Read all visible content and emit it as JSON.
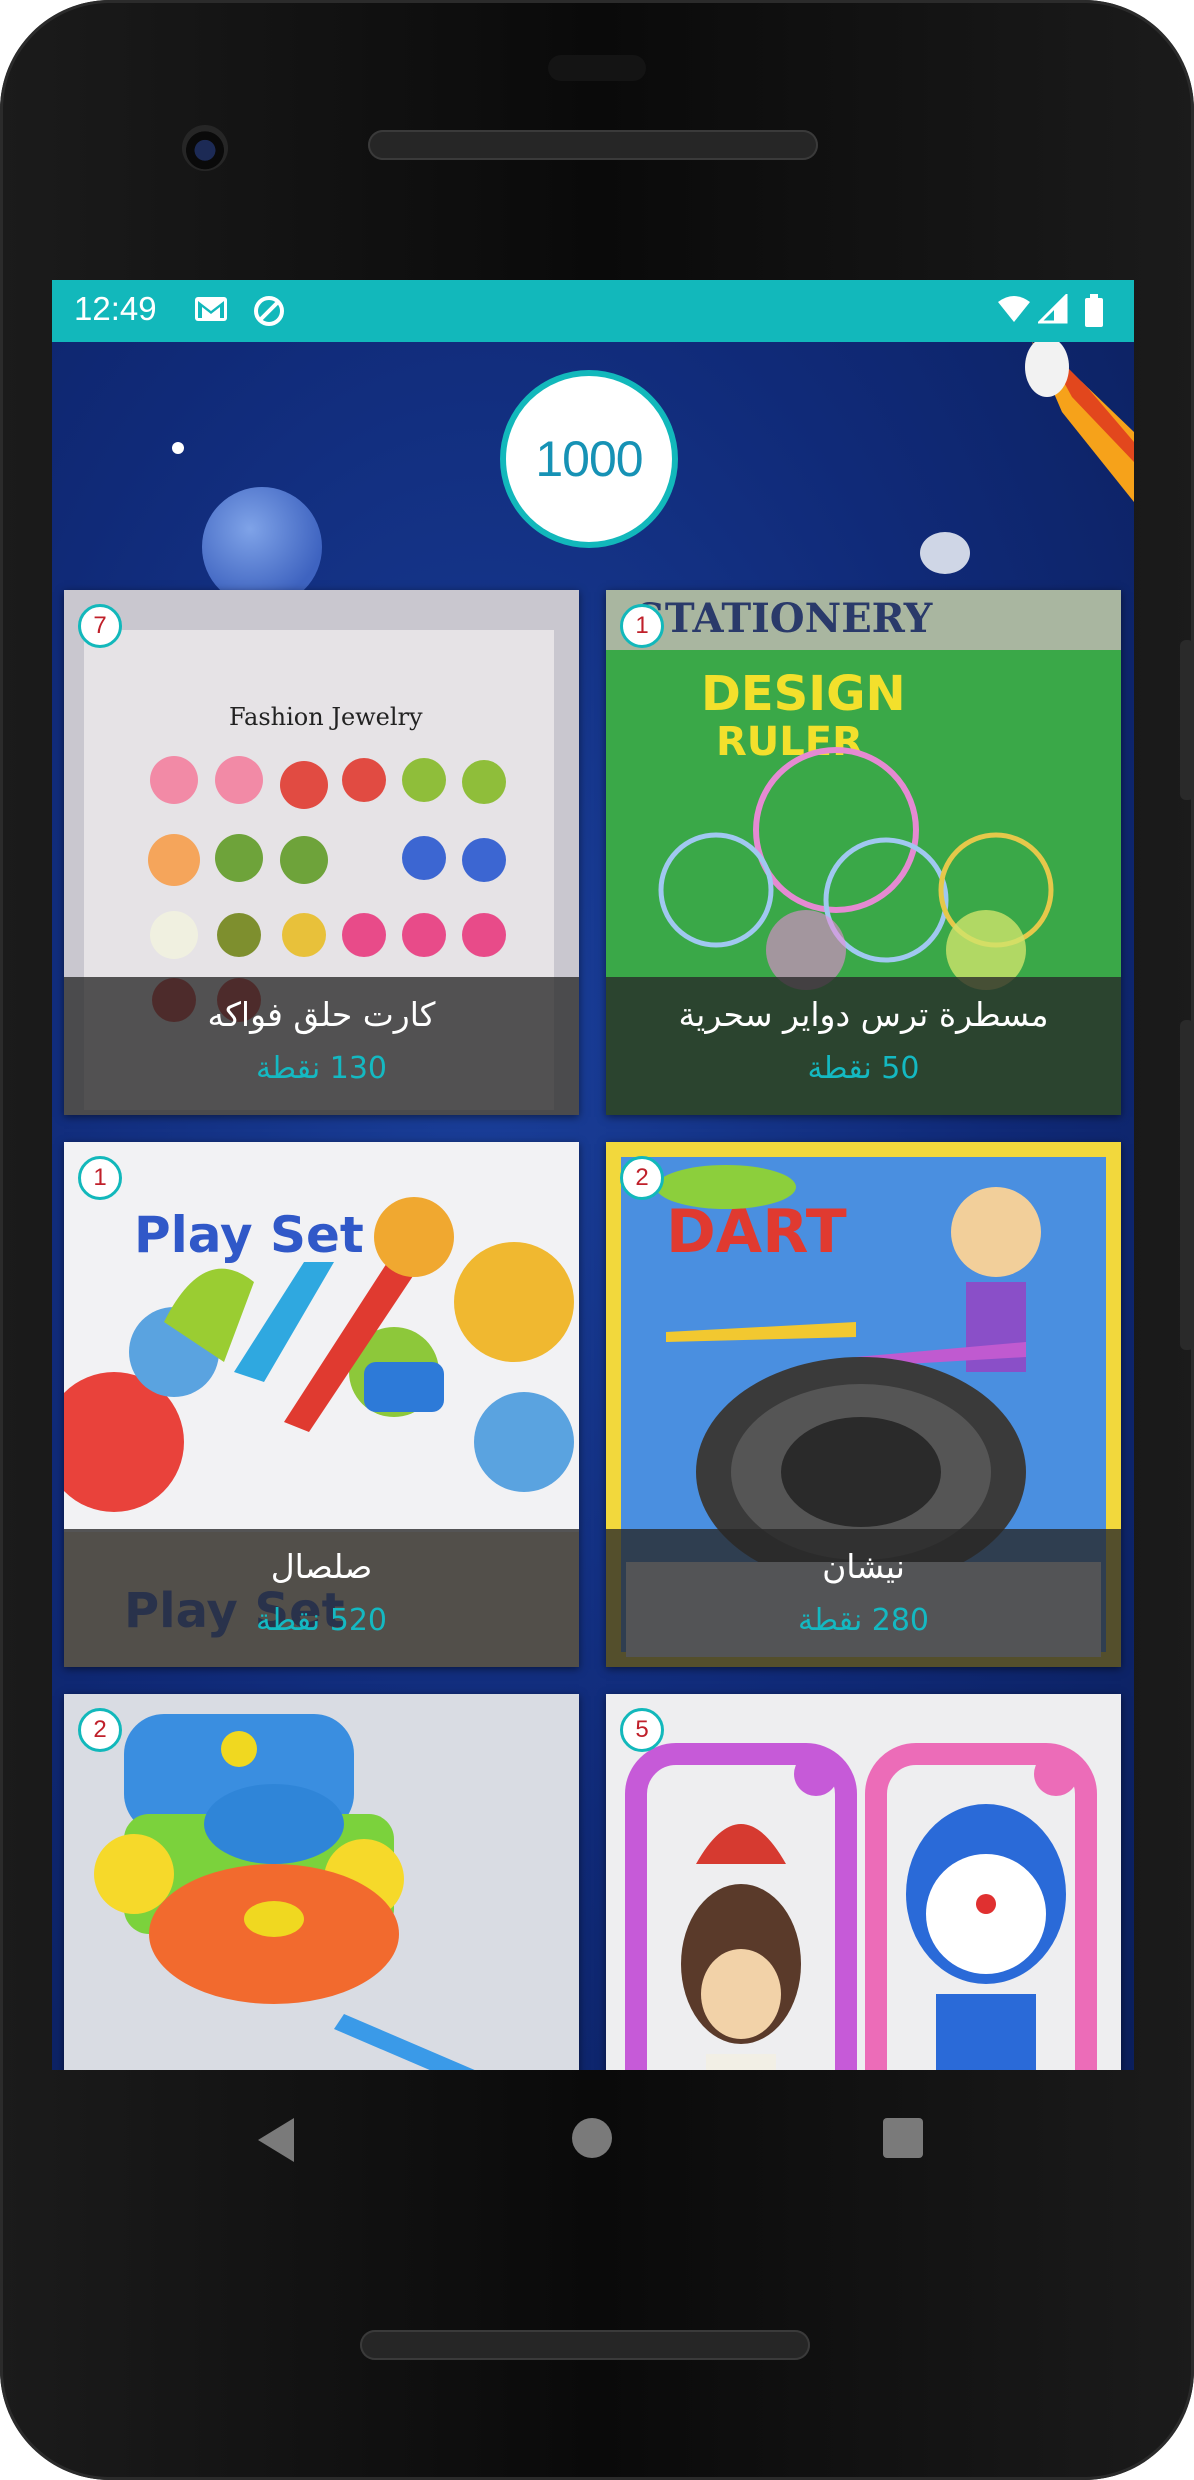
{
  "status_bar": {
    "time": "12:49",
    "icons": [
      "gmail-icon",
      "sync-icon",
      "wifi-icon",
      "signal-icon",
      "battery-icon"
    ]
  },
  "points_balance": "1000",
  "products": [
    {
      "name": "كارت حلق فواكه",
      "price": "130 نقطة",
      "quantity": "7",
      "image": "fruit-earrings-card"
    },
    {
      "name": "مسطرة ترس دواير سحرية",
      "price": "50 نقطة",
      "quantity": "1",
      "image": "design-ruler"
    },
    {
      "name": "صلصال",
      "price": "520 نقطة",
      "quantity": "1",
      "image": "play-set-clay"
    },
    {
      "name": "نيشان",
      "price": "280 نقطة",
      "quantity": "2",
      "image": "dart-game-set"
    },
    {
      "name": "",
      "price": "",
      "quantity": "2",
      "image": "toy-train"
    },
    {
      "name": "",
      "price": "",
      "quantity": "5",
      "image": "character-phone-bumpers"
    }
  ],
  "navigation": [
    "back-icon",
    "home-icon",
    "recent-apps-icon"
  ],
  "colors": {
    "accent": "#12b8bb",
    "background": "#102a78",
    "badge_text": "#c0202a",
    "price_text": "#14b9c2"
  }
}
